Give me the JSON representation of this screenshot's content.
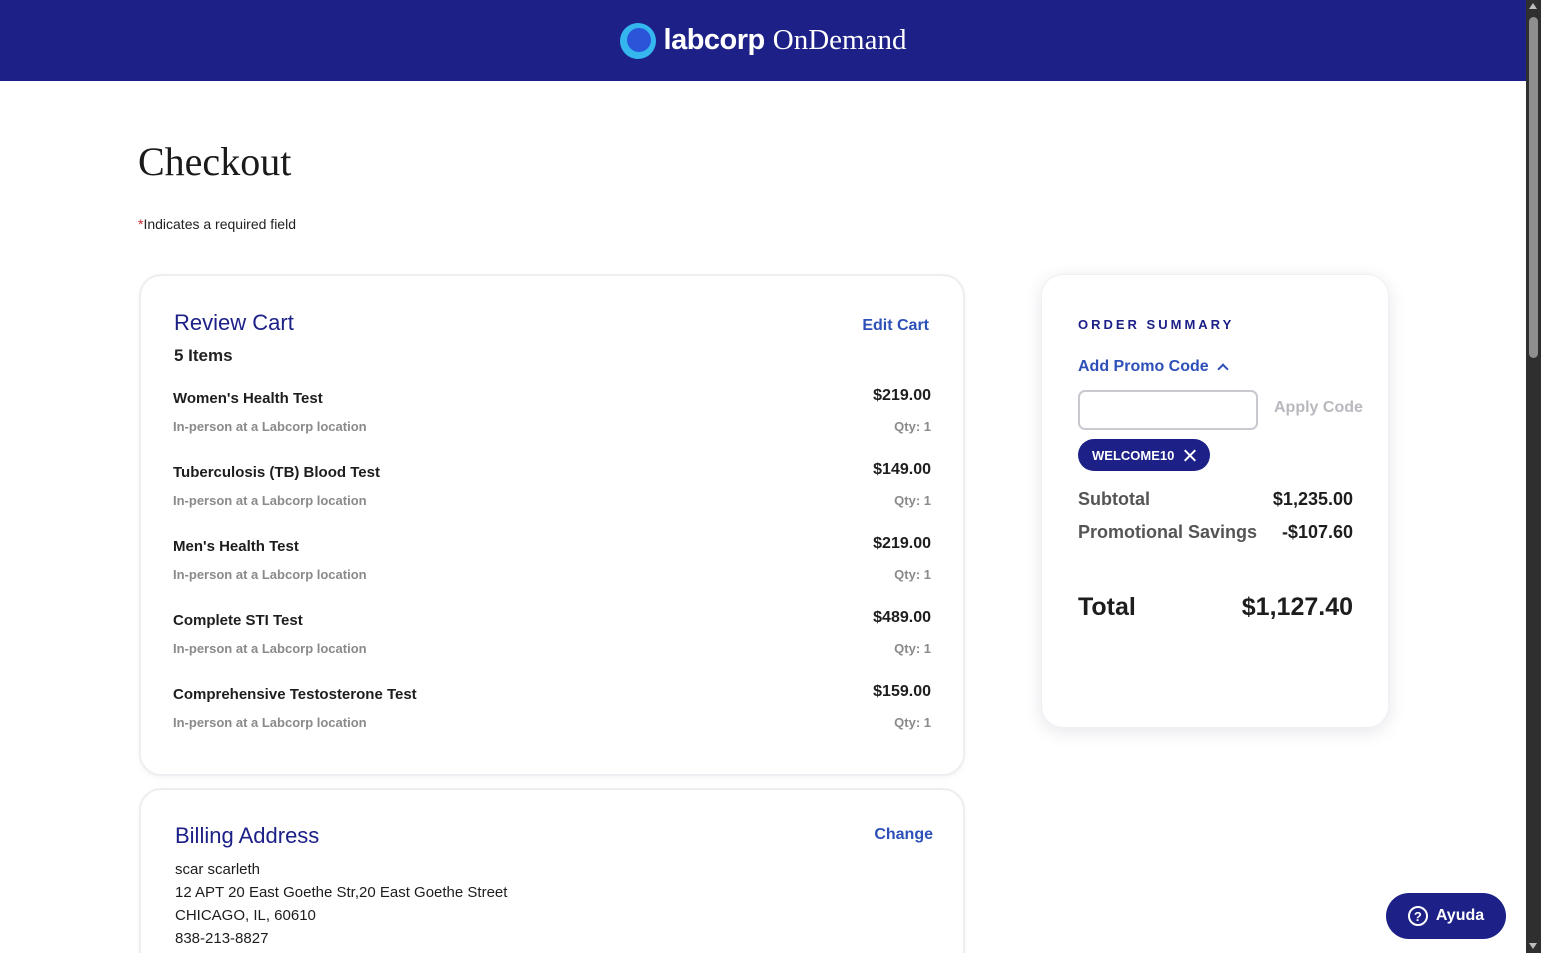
{
  "header": {
    "brand": "labcorp",
    "brand_sub": "OnDemand"
  },
  "page": {
    "title": "Checkout",
    "required_star": "*",
    "required_note": "Indicates a required field"
  },
  "cart": {
    "title": "Review Cart",
    "edit_label": "Edit Cart",
    "count_label": "5 Items",
    "items": [
      {
        "name": "Women's Health Test",
        "sub": "In-person at a Labcorp location",
        "price": "$219.00",
        "qty": "Qty: 1"
      },
      {
        "name": "Tuberculosis (TB) Blood Test",
        "sub": "In-person at a Labcorp location",
        "price": "$149.00",
        "qty": "Qty: 1"
      },
      {
        "name": "Men's Health Test",
        "sub": "In-person at a Labcorp location",
        "price": "$219.00",
        "qty": "Qty: 1"
      },
      {
        "name": "Complete STI Test",
        "sub": "In-person at a Labcorp location",
        "price": "$489.00",
        "qty": "Qty: 1"
      },
      {
        "name": "Comprehensive Testosterone Test",
        "sub": "In-person at a Labcorp location",
        "price": "$159.00",
        "qty": "Qty: 1"
      }
    ]
  },
  "billing": {
    "title": "Billing Address",
    "change_label": "Change",
    "name": "scar scarleth",
    "street": "12 APT 20 East Goethe Str,20 East Goethe Street",
    "city_line": "CHICAGO, IL, 60610",
    "phone": "838-213-8827"
  },
  "summary": {
    "title": "ORDER SUMMARY",
    "promo_toggle": "Add Promo Code",
    "promo_input_value": "",
    "apply_label": "Apply Code",
    "applied_code": "WELCOME10",
    "subtotal_label": "Subtotal",
    "subtotal_value": "$1,235.00",
    "savings_label": "Promotional Savings",
    "savings_value": "-$107.60",
    "total_label": "Total",
    "total_value": "$1,127.40"
  },
  "help": {
    "icon_glyph": "?",
    "label": "Ayuda"
  },
  "colors": {
    "brand_navy": "#1c2087",
    "link_blue": "#2d4fb8",
    "logo_cyan": "#35b6ef"
  }
}
